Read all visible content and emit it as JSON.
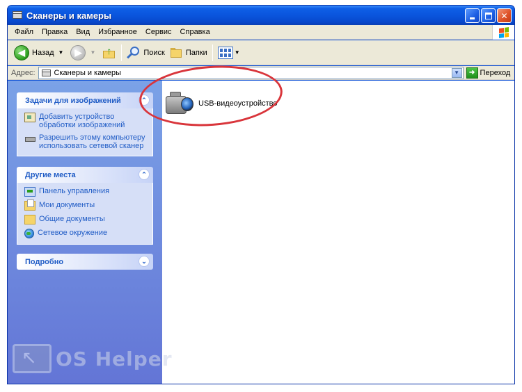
{
  "window": {
    "title": "Сканеры и камеры"
  },
  "menu": [
    "Файл",
    "Правка",
    "Вид",
    "Избранное",
    "Сервис",
    "Справка"
  ],
  "toolbar": {
    "back_label": "Назад",
    "search_label": "Поиск",
    "folders_label": "Папки"
  },
  "address": {
    "label": "Адрес:",
    "value": "Сканеры и камеры",
    "go_label": "Переход"
  },
  "tasks_pane": {
    "image_tasks": {
      "title": "Задачи для изображений",
      "items": [
        {
          "label": "Добавить устройство обработки изображений",
          "icon": "add-device-icon"
        },
        {
          "label": "Разрешить этому компьютеру использовать сетевой сканер",
          "icon": "network-scanner-icon"
        }
      ]
    },
    "other_places": {
      "title": "Другие места",
      "items": [
        {
          "label": "Панель управления",
          "icon": "control-panel-icon"
        },
        {
          "label": "Мои документы",
          "icon": "my-documents-icon"
        },
        {
          "label": "Общие документы",
          "icon": "shared-documents-icon"
        },
        {
          "label": "Сетевое окружение",
          "icon": "network-places-icon"
        }
      ]
    },
    "details": {
      "title": "Подробно"
    }
  },
  "content": {
    "items": [
      {
        "label": "USB-видеоустройство",
        "icon": "camcorder-icon"
      }
    ]
  },
  "watermark": {
    "text": "OS Helper"
  },
  "colors": {
    "titlebar": "#0a55dd",
    "tasks_pane": "#6f8ee0",
    "link": "#215dc6",
    "highlight": "#d9353b"
  }
}
